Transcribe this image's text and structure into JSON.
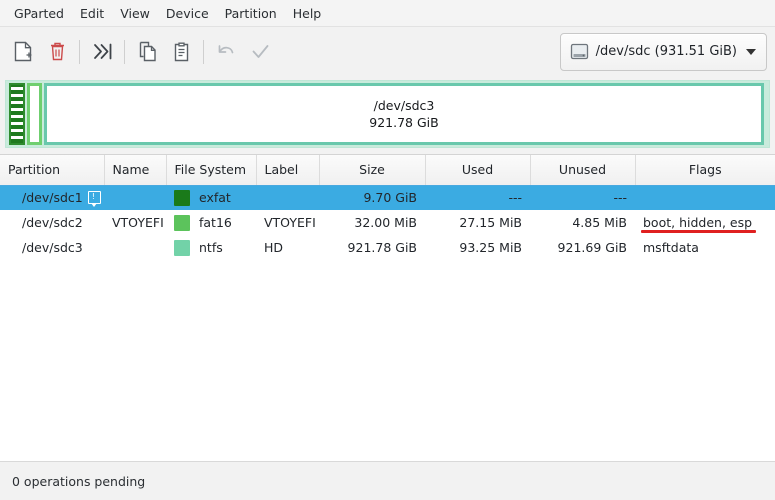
{
  "app": {
    "title": "GParted"
  },
  "menubar": {
    "items": [
      {
        "label": "GParted",
        "name": "menu-gparted"
      },
      {
        "label": "Edit",
        "name": "menu-edit"
      },
      {
        "label": "View",
        "name": "menu-view"
      },
      {
        "label": "Device",
        "name": "menu-device"
      },
      {
        "label": "Partition",
        "name": "menu-partition"
      },
      {
        "label": "Help",
        "name": "menu-help"
      }
    ]
  },
  "toolbar": {
    "buttons": [
      {
        "icon": "new-partition-icon",
        "enabled": true
      },
      {
        "icon": "delete-partition-icon",
        "enabled": true
      },
      {
        "icon": "resize-move-icon",
        "enabled": true
      },
      {
        "icon": "copy-icon",
        "enabled": true
      },
      {
        "icon": "paste-icon",
        "enabled": true
      },
      {
        "icon": "undo-icon",
        "enabled": false
      },
      {
        "icon": "apply-icon",
        "enabled": false
      }
    ],
    "device_selector": {
      "label": "/dev/sdc (931.51 GiB)",
      "icon": "hard-disk-icon"
    }
  },
  "diskmap": {
    "partitions": [
      {
        "name": "/dev/sdc1",
        "size": "",
        "color": "#1f7a1f",
        "show_label": false
      },
      {
        "name": "/dev/sdc2",
        "size": "",
        "color": "#6fcf6f",
        "show_label": false
      },
      {
        "name": "/dev/sdc3",
        "size": "921.78 GiB",
        "color": "#69c8ac",
        "show_label": true
      }
    ]
  },
  "table": {
    "headers": [
      "Partition",
      "Name",
      "File System",
      "Label",
      "Size",
      "Used",
      "Unused",
      "Flags"
    ],
    "rows": [
      {
        "partition": "/dev/sdc1",
        "name": "",
        "filesystem": "exfat",
        "fs_color": "#1a7a1a",
        "label": "",
        "size": "9.70 GiB",
        "used": "---",
        "unused": "---",
        "flags": "",
        "selected": true,
        "has_info_icon": true,
        "flags_underlined": false
      },
      {
        "partition": "/dev/sdc2",
        "name": "VTOYEFI",
        "filesystem": "fat16",
        "fs_color": "#5cc35c",
        "label": "VTOYEFI",
        "size": "32.00 MiB",
        "used": "27.15 MiB",
        "unused": "4.85 MiB",
        "flags": "boot, hidden, esp",
        "selected": false,
        "has_info_icon": false,
        "flags_underlined": true
      },
      {
        "partition": "/dev/sdc3",
        "name": "",
        "filesystem": "ntfs",
        "fs_color": "#72d2a8",
        "label": "HD",
        "size": "921.78 GiB",
        "used": "93.25 MiB",
        "unused": "921.69 GiB",
        "flags": "msftdata",
        "selected": false,
        "has_info_icon": false,
        "flags_underlined": false
      }
    ]
  },
  "statusbar": {
    "text": "0 operations pending"
  },
  "colors": {
    "selection": "#3babe2",
    "annotation": "#e02020",
    "header_accent": "#49a9e0"
  }
}
